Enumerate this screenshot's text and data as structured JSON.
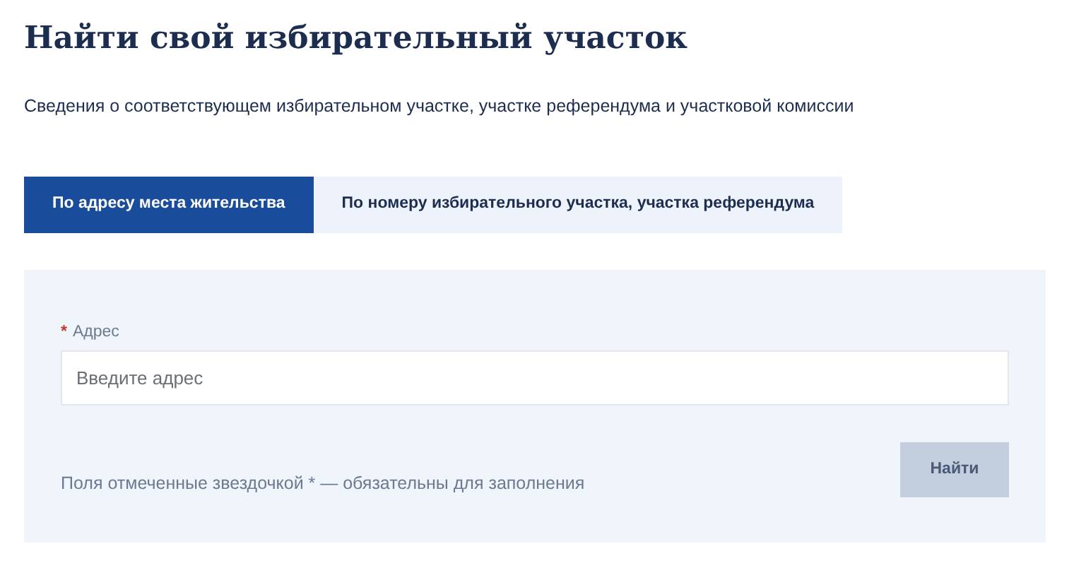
{
  "title": "Найти свой избирательный участок",
  "subtitle": "Сведения о соответствующем избирательном участке, участке референдума и участковой комиссии",
  "tabs": [
    {
      "label": "По адресу места жительства",
      "selected": true
    },
    {
      "label": "По номеру избирательного участка, участка референдума",
      "selected": false
    }
  ],
  "form": {
    "field": {
      "required_mark": "*",
      "label": "Адрес",
      "required": true,
      "placeholder": "Введите адрес"
    },
    "note": "Поля отмеченные звездочкой * — обязательны для заполнения",
    "submit": {
      "label": "Найти",
      "disabled": true
    }
  }
}
